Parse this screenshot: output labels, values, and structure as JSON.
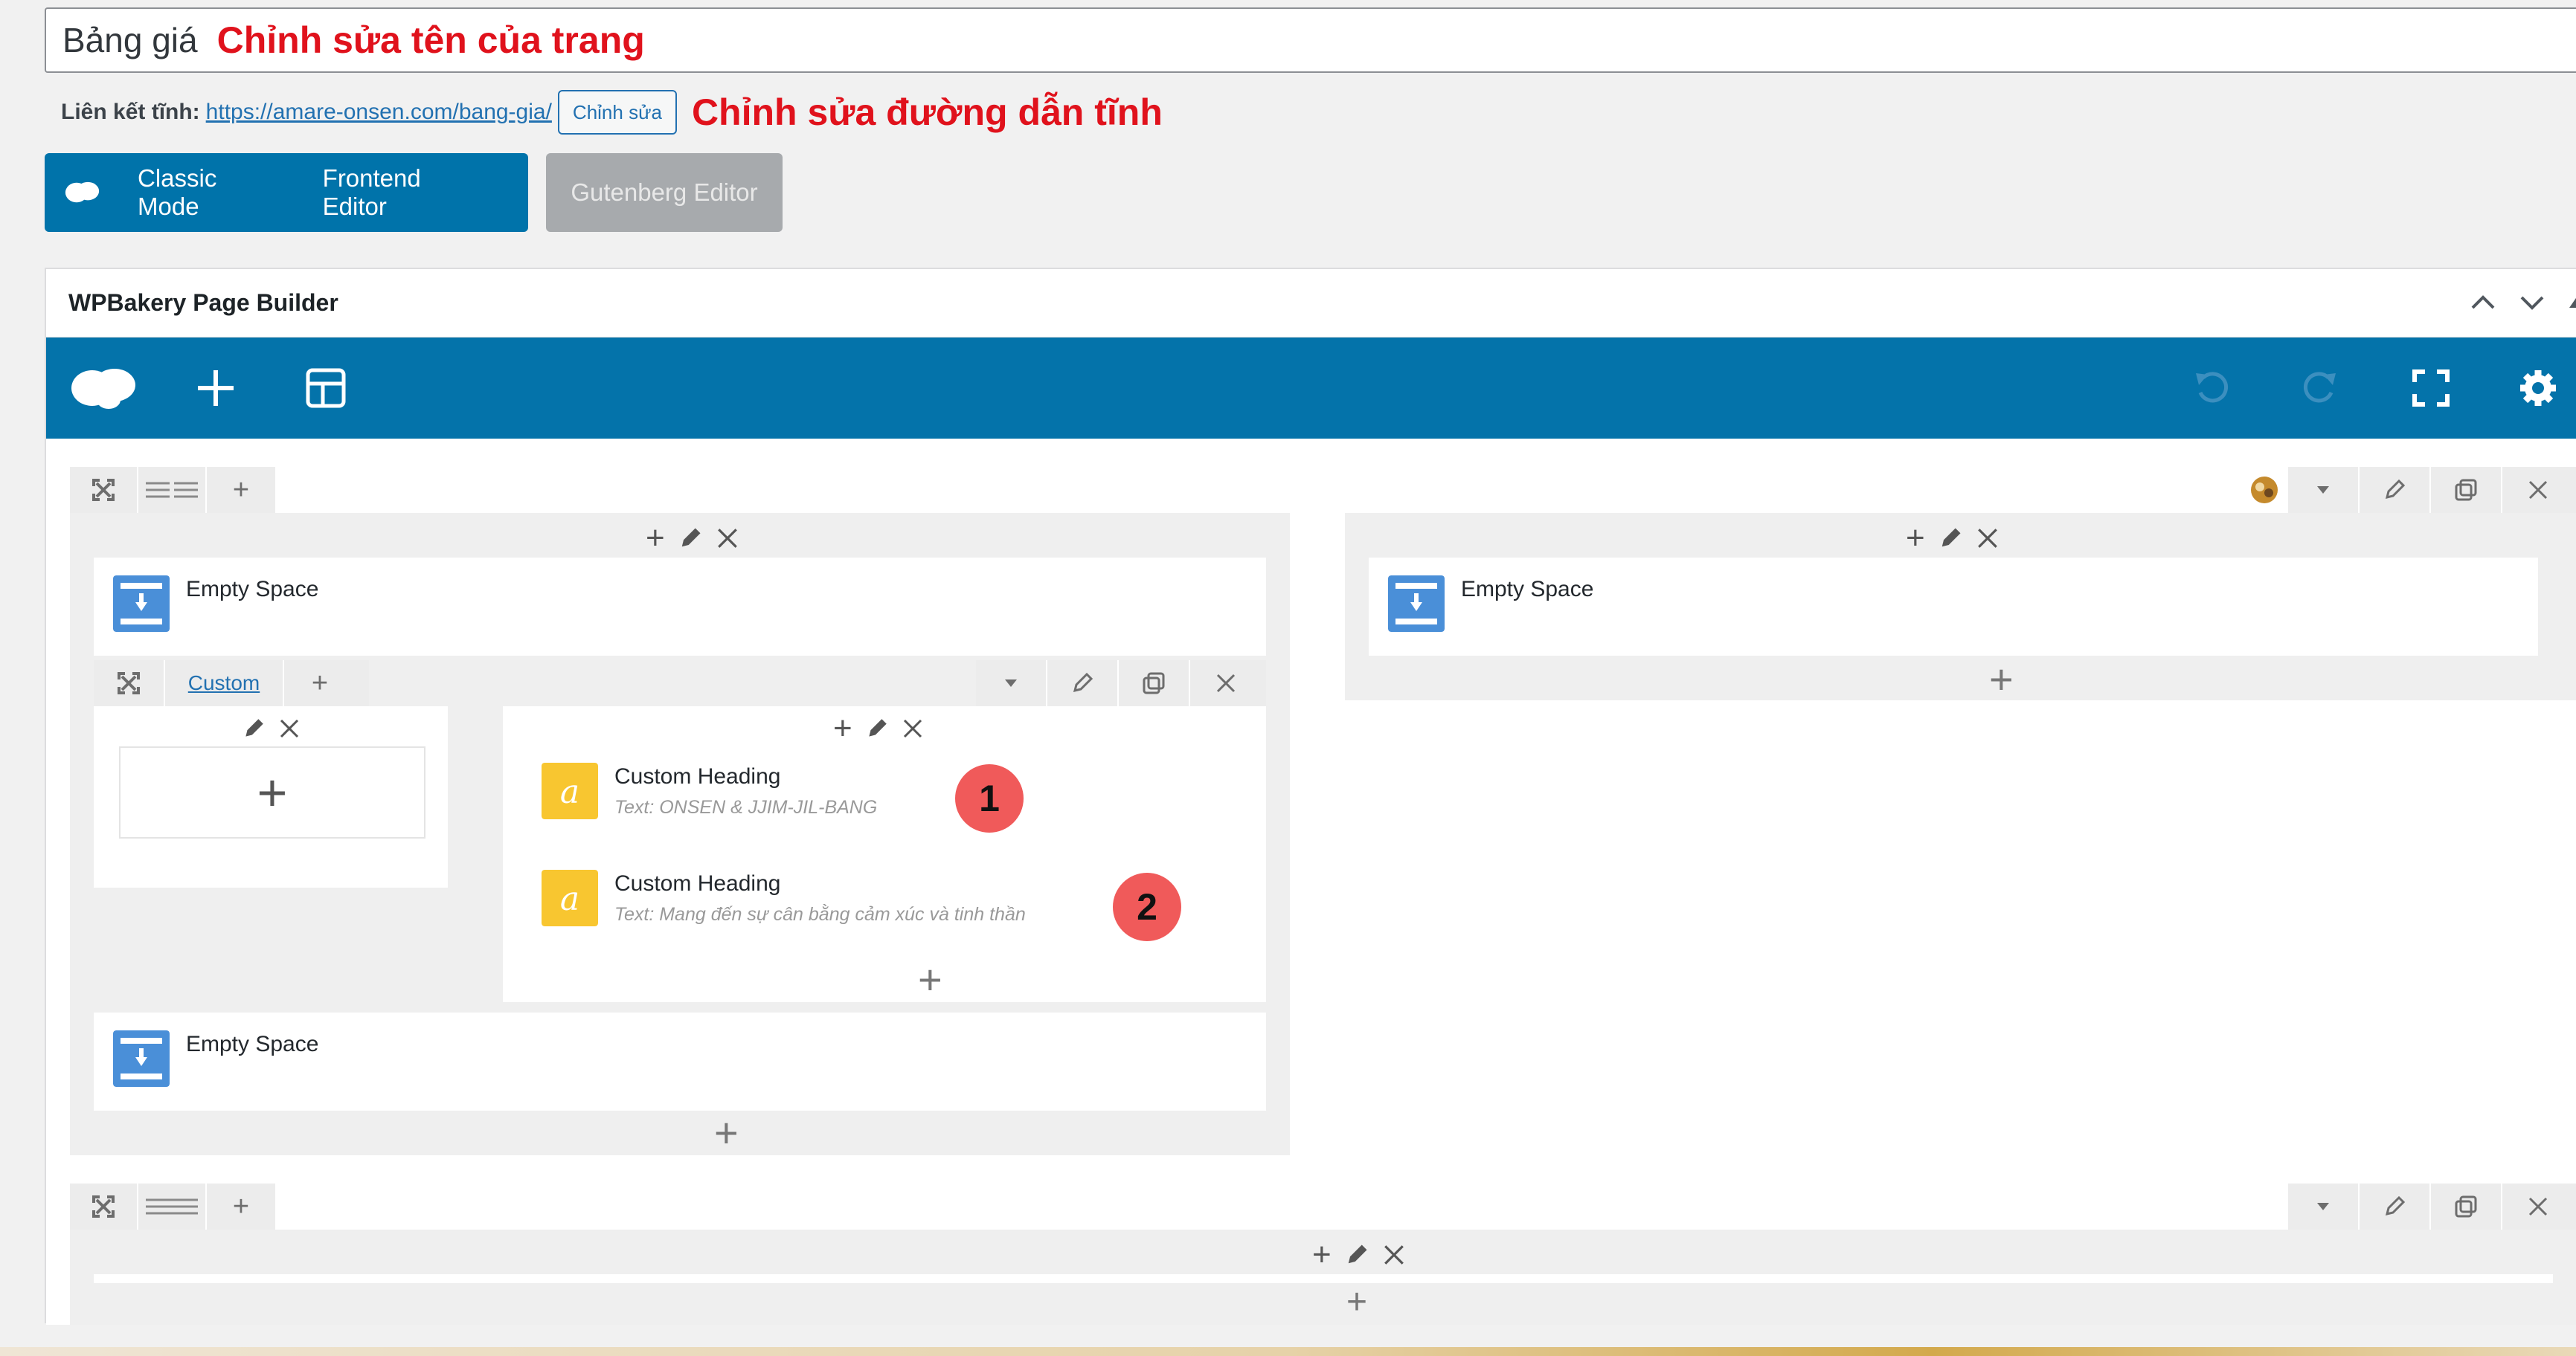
{
  "title": {
    "value": "Bảng giá",
    "note": "Chỉnh sửa tên của trang"
  },
  "permalink": {
    "label": "Liên kết tĩnh:",
    "url": "https://amare-onsen.com/bang-gia/",
    "edit_label": "Chỉnh sửa",
    "note": "Chỉnh sửa đường dẫn tĩnh"
  },
  "modes": {
    "classic": "Classic Mode",
    "frontend": "Frontend Editor",
    "gutenberg": "Gutenberg Editor"
  },
  "panel": {
    "title": "WPBakery Page Builder"
  },
  "inner_row": {
    "label": "Custom"
  },
  "elements": {
    "empty_space": "Empty Space",
    "heading_1_title": "Custom Heading",
    "heading_1_text": "Text: ONSEN & JJIM-JIL-BANG",
    "heading_2_title": "Custom Heading",
    "heading_2_text": "Text: Mang đến sự cân bằng cảm xúc và tinh thần"
  },
  "badges": [
    "1",
    "2"
  ],
  "colors": {
    "accent": "#0473aa",
    "note_red": "#e0121c",
    "badge": "#f05a5a",
    "heading_icon": "#f8c630",
    "space_icon": "#4a8fd8"
  }
}
